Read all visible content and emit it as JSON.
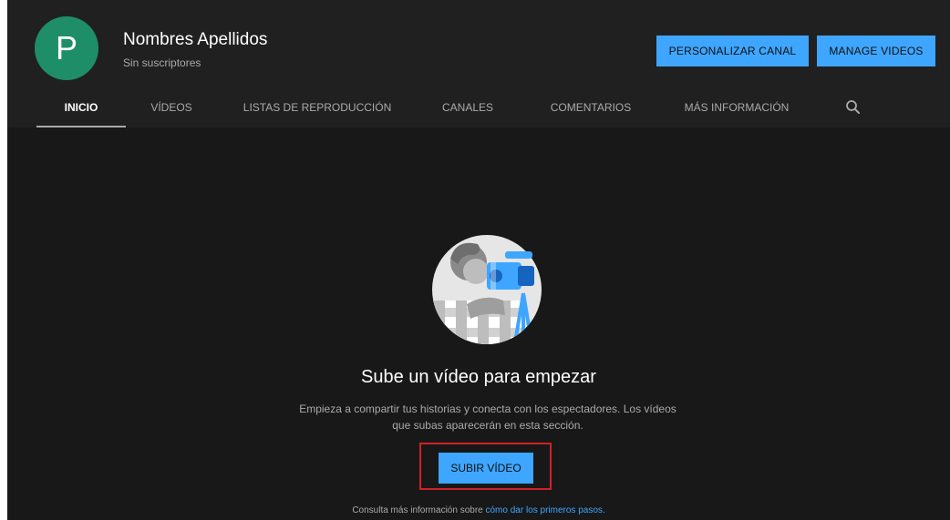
{
  "channel": {
    "avatar_letter": "P",
    "avatar_color": "#1e8e68",
    "name": "Nombres Apellidos",
    "subscribers": "Sin suscriptores"
  },
  "header_buttons": {
    "customize": "PERSONALIZAR CANAL",
    "manage": "MANAGE VIDEOS"
  },
  "tabs": [
    {
      "label": "INICIO",
      "active": true
    },
    {
      "label": "VÍDEOS",
      "active": false
    },
    {
      "label": "LISTAS DE REPRODUCCIÓN",
      "active": false
    },
    {
      "label": "CANALES",
      "active": false
    },
    {
      "label": "COMENTARIOS",
      "active": false
    },
    {
      "label": "MÁS INFORMACIÓN",
      "active": false
    }
  ],
  "search_icon": "search-icon",
  "empty_state": {
    "title": "Sube un vídeo para empezar",
    "description": "Empieza a compartir tus historias y conecta con los espectadores. Los vídeos que subas aparecerán en esta sección.",
    "upload_button": "SUBIR VÍDEO",
    "footer_prefix": "Consulta más información sobre",
    "footer_link": "cómo dar los primeros pasos."
  },
  "colors": {
    "accent": "#3ea6ff",
    "background": "#181818",
    "header": "#202020",
    "highlight_border": "#d0202a"
  }
}
